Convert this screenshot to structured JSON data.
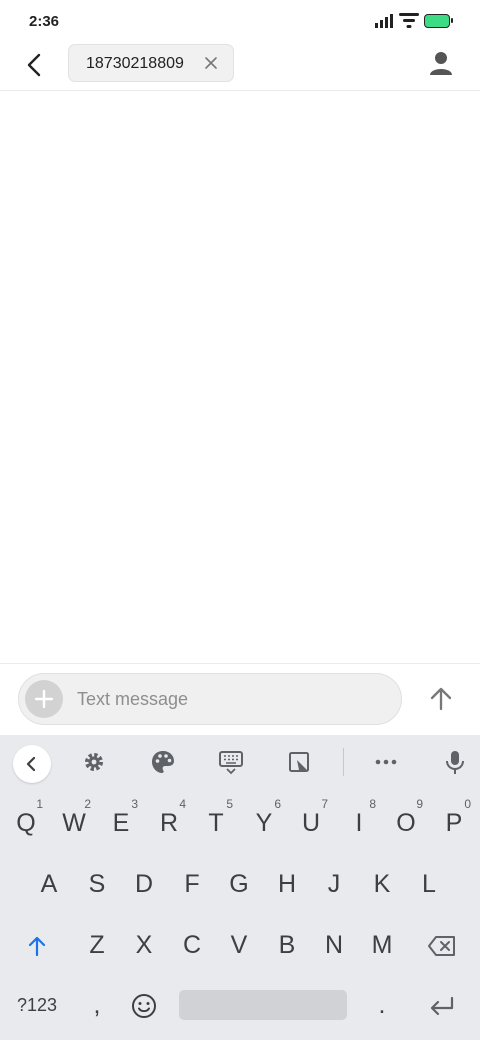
{
  "status_bar": {
    "time": "2:36"
  },
  "header": {
    "recipient": "18730218809"
  },
  "compose": {
    "placeholder": "Text message"
  },
  "keyboard": {
    "row1": [
      {
        "label": "Q",
        "hint": "1"
      },
      {
        "label": "W",
        "hint": "2"
      },
      {
        "label": "E",
        "hint": "3"
      },
      {
        "label": "R",
        "hint": "4"
      },
      {
        "label": "T",
        "hint": "5"
      },
      {
        "label": "Y",
        "hint": "6"
      },
      {
        "label": "U",
        "hint": "7"
      },
      {
        "label": "I",
        "hint": "8"
      },
      {
        "label": "O",
        "hint": "9"
      },
      {
        "label": "P",
        "hint": "0"
      }
    ],
    "row2": [
      "A",
      "S",
      "D",
      "F",
      "G",
      "H",
      "J",
      "K",
      "L"
    ],
    "row3": [
      "Z",
      "X",
      "C",
      "V",
      "B",
      "N",
      "M"
    ],
    "symbols_label": "?123",
    "comma": ",",
    "period": "."
  },
  "colors": {
    "battery": "#3ddc84",
    "accent": "#1a73e8",
    "keyboard_bg": "#e8eaed"
  }
}
